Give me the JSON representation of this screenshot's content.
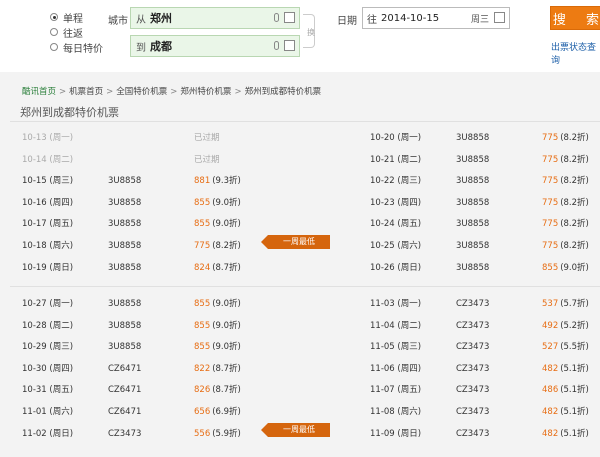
{
  "search": {
    "trip_types": [
      "单程",
      "往返",
      "每日特价"
    ],
    "city_label": "城市",
    "from_prefix": "从",
    "from_city": "郑州",
    "to_prefix": "到",
    "to_city": "成都",
    "swap_glyph": "换",
    "date_label": "日期",
    "date_prefix": "往",
    "date_value": "2014-10-15",
    "weekday": "周三",
    "search_button": "搜 索",
    "status_link": "出票状态查询"
  },
  "breadcrumb": [
    "酷讯首页",
    "机票首页",
    "全国特价机票",
    "郑州特价机票",
    "郑州到成都特价机票"
  ],
  "page_title": "郑州到成都特价机票",
  "expired_text": "已过期",
  "badge_text": "一周最低",
  "colors": {
    "accent": "#ed7b12",
    "price": "#e76d13",
    "link": "#1d5fa8",
    "field_bg": "#eaf6e8"
  },
  "block1": {
    "left": [
      {
        "date": "10-13 (周一)",
        "flight": "",
        "price": "",
        "discount": "",
        "expired": true,
        "badge": false
      },
      {
        "date": "10-14 (周二)",
        "flight": "",
        "price": "",
        "discount": "",
        "expired": true,
        "badge": false
      },
      {
        "date": "10-15 (周三)",
        "flight": "3U8858",
        "price": "881",
        "discount": "(9.3折)",
        "expired": false,
        "badge": false
      },
      {
        "date": "10-16 (周四)",
        "flight": "3U8858",
        "price": "855",
        "discount": "(9.0折)",
        "expired": false,
        "badge": false
      },
      {
        "date": "10-17 (周五)",
        "flight": "3U8858",
        "price": "855",
        "discount": "(9.0折)",
        "expired": false,
        "badge": false
      },
      {
        "date": "10-18 (周六)",
        "flight": "3U8858",
        "price": "775",
        "discount": "(8.2折)",
        "expired": false,
        "badge": true
      },
      {
        "date": "10-19 (周日)",
        "flight": "3U8858",
        "price": "824",
        "discount": "(8.7折)",
        "expired": false,
        "badge": false
      }
    ],
    "right": [
      {
        "date": "10-20 (周一)",
        "flight": "3U8858",
        "price": "775",
        "discount": "(8.2折)",
        "expired": false,
        "badge": false
      },
      {
        "date": "10-21 (周二)",
        "flight": "3U8858",
        "price": "775",
        "discount": "(8.2折)",
        "expired": false,
        "badge": false
      },
      {
        "date": "10-22 (周三)",
        "flight": "3U8858",
        "price": "775",
        "discount": "(8.2折)",
        "expired": false,
        "badge": false
      },
      {
        "date": "10-23 (周四)",
        "flight": "3U8858",
        "price": "775",
        "discount": "(8.2折)",
        "expired": false,
        "badge": false
      },
      {
        "date": "10-24 (周五)",
        "flight": "3U8858",
        "price": "775",
        "discount": "(8.2折)",
        "expired": false,
        "badge": false
      },
      {
        "date": "10-25 (周六)",
        "flight": "3U8858",
        "price": "775",
        "discount": "(8.2折)",
        "expired": false,
        "badge": false
      },
      {
        "date": "10-26 (周日)",
        "flight": "3U8858",
        "price": "855",
        "discount": "(9.0折)",
        "expired": false,
        "badge": false
      }
    ]
  },
  "block2": {
    "left": [
      {
        "date": "10-27 (周一)",
        "flight": "3U8858",
        "price": "855",
        "discount": "(9.0折)",
        "expired": false,
        "badge": false
      },
      {
        "date": "10-28 (周二)",
        "flight": "3U8858",
        "price": "855",
        "discount": "(9.0折)",
        "expired": false,
        "badge": false
      },
      {
        "date": "10-29 (周三)",
        "flight": "3U8858",
        "price": "855",
        "discount": "(9.0折)",
        "expired": false,
        "badge": false
      },
      {
        "date": "10-30 (周四)",
        "flight": "CZ6471",
        "price": "822",
        "discount": "(8.7折)",
        "expired": false,
        "badge": false
      },
      {
        "date": "10-31 (周五)",
        "flight": "CZ6471",
        "price": "826",
        "discount": "(8.7折)",
        "expired": false,
        "badge": false
      },
      {
        "date": "11-01 (周六)",
        "flight": "CZ6471",
        "price": "656",
        "discount": "(6.9折)",
        "expired": false,
        "badge": false
      },
      {
        "date": "11-02 (周日)",
        "flight": "CZ3473",
        "price": "556",
        "discount": "(5.9折)",
        "expired": false,
        "badge": true
      }
    ],
    "right": [
      {
        "date": "11-03 (周一)",
        "flight": "CZ3473",
        "price": "537",
        "discount": "(5.7折)",
        "expired": false,
        "badge": false
      },
      {
        "date": "11-04 (周二)",
        "flight": "CZ3473",
        "price": "492",
        "discount": "(5.2折)",
        "expired": false,
        "badge": false
      },
      {
        "date": "11-05 (周三)",
        "flight": "CZ3473",
        "price": "527",
        "discount": "(5.5折)",
        "expired": false,
        "badge": false
      },
      {
        "date": "11-06 (周四)",
        "flight": "CZ3473",
        "price": "482",
        "discount": "(5.1折)",
        "expired": false,
        "badge": false
      },
      {
        "date": "11-07 (周五)",
        "flight": "CZ3473",
        "price": "486",
        "discount": "(5.1折)",
        "expired": false,
        "badge": false
      },
      {
        "date": "11-08 (周六)",
        "flight": "CZ3473",
        "price": "482",
        "discount": "(5.1折)",
        "expired": false,
        "badge": false
      },
      {
        "date": "11-09 (周日)",
        "flight": "CZ3473",
        "price": "482",
        "discount": "(5.1折)",
        "expired": false,
        "badge": false
      }
    ]
  }
}
